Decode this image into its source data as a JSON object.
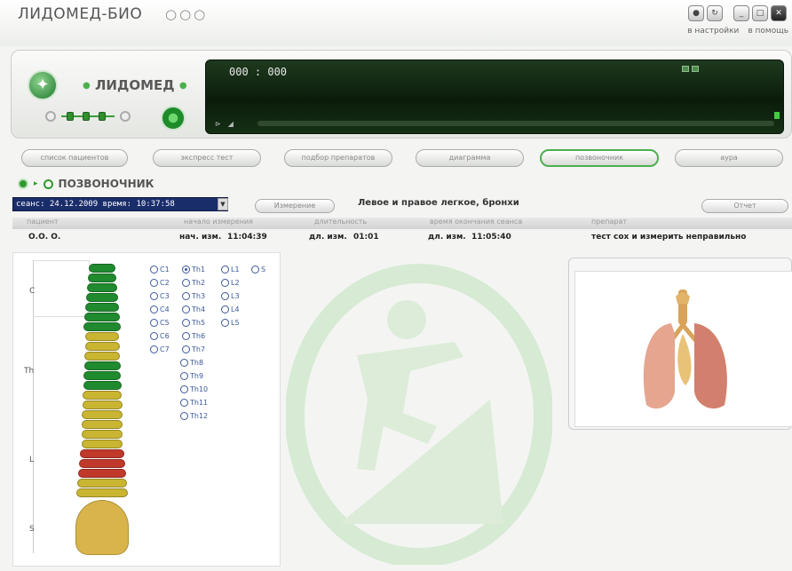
{
  "app": {
    "title": "ЛИДОМЕД-БИО",
    "title_dots": "○○○",
    "links": {
      "settings": "в настройки",
      "help": "в помощь"
    }
  },
  "header": {
    "logo_text": "ЛИДОМЕД",
    "display_time": "000 : 000"
  },
  "nav": {
    "tabs": [
      {
        "label": "список пациентов"
      },
      {
        "label": "экспресс тест"
      },
      {
        "label": "подбор препаратов"
      },
      {
        "label": "диаграмма"
      },
      {
        "label": "позвоночник",
        "active": true
      },
      {
        "label": "аура"
      }
    ]
  },
  "section": {
    "title": "ПОЗВОНОЧНИК"
  },
  "session": {
    "value": "сеанс: 24.12.2009  время: 10:37:58",
    "measure_button": "Измерение",
    "organ_label": "Левое и правое легкое, бронхи",
    "report_button": "Отчет"
  },
  "table": {
    "headers": [
      "пациент",
      "начало измерения",
      "длительность",
      "время окончания сеанса",
      "препарат"
    ],
    "row": {
      "patient": "О.О. О.",
      "start_label": "нач. изм.",
      "start": "11:04:39",
      "duration_label": "дл. изм.",
      "duration": "01:01",
      "end_label": "дл. изм.",
      "end": "11:05:40",
      "drug": "тест сох и измерить неправильно"
    }
  },
  "spine": {
    "regions": [
      "C",
      "Th",
      "L",
      "S"
    ],
    "radio_col1": [
      "C1",
      "C2",
      "C3",
      "C4",
      "C5",
      "C6",
      "C7"
    ],
    "radio_col2": [
      "Th1",
      "Th2",
      "Th3",
      "Th4",
      "Th5",
      "Th6",
      "Th7",
      "Th8",
      "Th9",
      "Th10",
      "Th11",
      "Th12"
    ],
    "radio_col3": [
      "L1",
      "L2",
      "L3",
      "L4",
      "L5"
    ],
    "radio_col4": [
      "S"
    ],
    "selected": "Th1",
    "colors": {
      "green": "#1f8a2e",
      "yellow": "#c9b531",
      "red": "#c0392b",
      "sacrum": "#d9b44a"
    }
  },
  "accent_color": "#2e9a2e"
}
